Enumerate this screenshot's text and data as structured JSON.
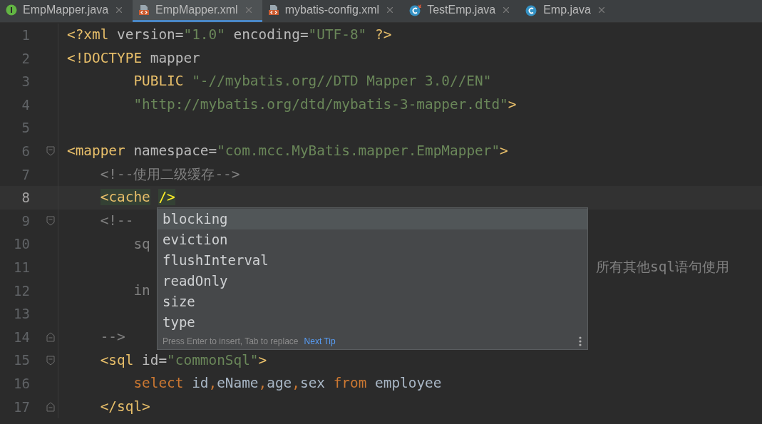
{
  "tabs": [
    {
      "label": "EmpMapper.java",
      "kind": "interface",
      "selected": false
    },
    {
      "label": "EmpMapper.xml",
      "kind": "xml",
      "selected": true
    },
    {
      "label": "mybatis-config.xml",
      "kind": "xml",
      "selected": false
    },
    {
      "label": "TestEmp.java",
      "kind": "test-class",
      "selected": false
    },
    {
      "label": "Emp.java",
      "kind": "class",
      "selected": false
    }
  ],
  "editor": {
    "lines": [
      {
        "number": "1",
        "current": false,
        "tokens": [
          {
            "kind": "tag",
            "text": "<?xml "
          },
          {
            "kind": "attr",
            "text": "version="
          },
          {
            "kind": "str",
            "text": "\"1.0\" "
          },
          {
            "kind": "attr",
            "text": "encoding="
          },
          {
            "kind": "str",
            "text": "\"UTF-8\" "
          },
          {
            "kind": "tag",
            "text": "?>"
          }
        ]
      },
      {
        "number": "2",
        "current": false,
        "tokens": [
          {
            "kind": "tag",
            "text": "<!DOCTYPE "
          },
          {
            "kind": "attr",
            "text": "mapper"
          }
        ]
      },
      {
        "number": "3",
        "current": false,
        "tokens": [
          {
            "kind": "tag",
            "text": "        PUBLIC "
          },
          {
            "kind": "str",
            "text": "\"-//mybatis.org//DTD Mapper 3.0//EN\""
          }
        ]
      },
      {
        "number": "4",
        "current": false,
        "tokens": [
          {
            "kind": "str",
            "text": "        \"http://mybatis.org/dtd/mybatis-3-mapper.dtd\""
          },
          {
            "kind": "tag",
            "text": ">"
          }
        ]
      },
      {
        "number": "5",
        "current": false
      },
      {
        "number": "6",
        "current": false,
        "kind": "fold-start",
        "tokens": [
          {
            "kind": "tag",
            "text": "<mapper "
          },
          {
            "kind": "attr",
            "text": "namespace="
          },
          {
            "kind": "str",
            "text": "\"com.mcc.MyBatis.mapper.EmpMapper\""
          },
          {
            "kind": "tag",
            "text": ">"
          }
        ]
      },
      {
        "number": "7",
        "current": false,
        "tokens": [
          {
            "kind": "comment",
            "text": "    <!--使用二级缓存-->"
          }
        ]
      },
      {
        "number": "8",
        "current": true,
        "tokens": [
          {
            "kind": "match",
            "text": "    <cache"
          },
          {
            "kind": "match-end",
            "text": " />"
          }
        ]
      },
      {
        "number": "9",
        "current": false,
        "kind": "fold-start",
        "tokens": [
          {
            "kind": "comment",
            "text": "    <!--"
          }
        ]
      },
      {
        "number": "10",
        "current": false,
        "tokens": [
          {
            "kind": "comment",
            "text": "        sq"
          }
        ]
      },
      {
        "number": "11",
        "current": false,
        "tokens": [
          {
            "kind": "comment-tail",
            "text": "所有其他sql语句使用"
          }
        ]
      },
      {
        "number": "12",
        "current": false,
        "tokens": [
          {
            "kind": "comment",
            "text": "        in"
          }
        ]
      },
      {
        "number": "13",
        "current": false
      },
      {
        "number": "14",
        "current": false,
        "kind": "fold-end",
        "tokens": [
          {
            "kind": "comment",
            "text": "    -->"
          }
        ]
      },
      {
        "number": "15",
        "current": false,
        "kind": "fold-start",
        "tokens": [
          {
            "kind": "tag",
            "text": "    <sql "
          },
          {
            "kind": "attr",
            "text": "id="
          },
          {
            "kind": "str",
            "text": "\"commonSql\""
          },
          {
            "kind": "tag",
            "text": ">"
          }
        ]
      },
      {
        "number": "16",
        "current": false,
        "tokens": [
          {
            "kind": "keyword",
            "text": "        select "
          },
          {
            "kind": "plain",
            "text": "id"
          },
          {
            "kind": "keyword",
            "text": ","
          },
          {
            "kind": "plain",
            "text": "eName"
          },
          {
            "kind": "keyword",
            "text": ","
          },
          {
            "kind": "plain",
            "text": "age"
          },
          {
            "kind": "keyword",
            "text": ","
          },
          {
            "kind": "plain",
            "text": "sex "
          },
          {
            "kind": "keyword",
            "text": "from "
          },
          {
            "kind": "plain",
            "text": "employee"
          }
        ]
      },
      {
        "number": "17",
        "current": false,
        "kind": "fold-end",
        "tokens": [
          {
            "kind": "tag",
            "text": "    </sql>"
          }
        ]
      }
    ]
  },
  "completion": {
    "items": [
      {
        "label": "blocking",
        "selected": true
      },
      {
        "label": "eviction",
        "selected": false
      },
      {
        "label": "flushInterval",
        "selected": false
      },
      {
        "label": "readOnly",
        "selected": false
      },
      {
        "label": "size",
        "selected": false
      },
      {
        "label": "type",
        "selected": false
      }
    ],
    "hint": "Press Enter to insert, Tab to replace",
    "link": "Next Tip"
  }
}
